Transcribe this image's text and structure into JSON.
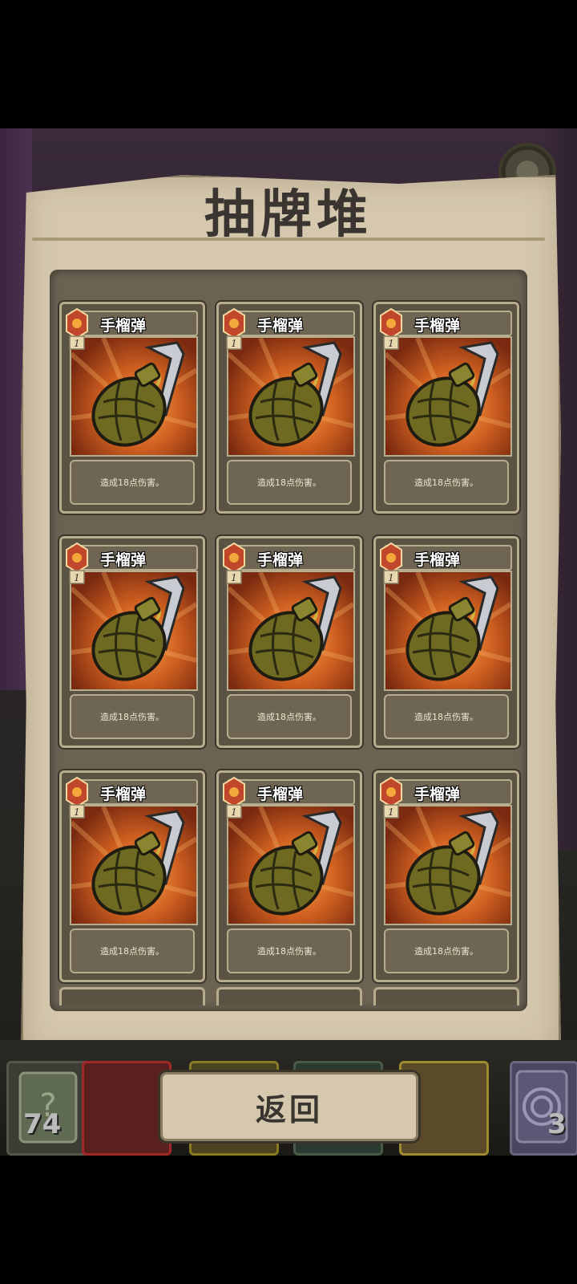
{
  "panel": {
    "title": "抽牌堆"
  },
  "cards": [
    {
      "name": "手榴弹",
      "cost": "1",
      "description": "造成18点伤害。"
    },
    {
      "name": "手榴弹",
      "cost": "1",
      "description": "造成18点伤害。"
    },
    {
      "name": "手榴弹",
      "cost": "1",
      "description": "造成18点伤害。"
    },
    {
      "name": "手榴弹",
      "cost": "1",
      "description": "造成18点伤害。"
    },
    {
      "name": "手榴弹",
      "cost": "1",
      "description": "造成18点伤害。"
    },
    {
      "name": "手榴弹",
      "cost": "1",
      "description": "造成18点伤害。"
    },
    {
      "name": "手榴弹",
      "cost": "1",
      "description": "造成18点伤害。"
    },
    {
      "name": "手榴弹",
      "cost": "1",
      "description": "造成18点伤害。"
    },
    {
      "name": "手榴弹",
      "cost": "1",
      "description": "造成18点伤害。"
    }
  ],
  "bottom_bar": {
    "draw_pile_count": "74",
    "discard_pile_count": "3",
    "back_label": "返回"
  },
  "colors": {
    "panel": "#d5c8ae",
    "card_frame": "#b8ac8e",
    "card_art_glow": "#d06020",
    "cost_gem": "#c0472a"
  }
}
